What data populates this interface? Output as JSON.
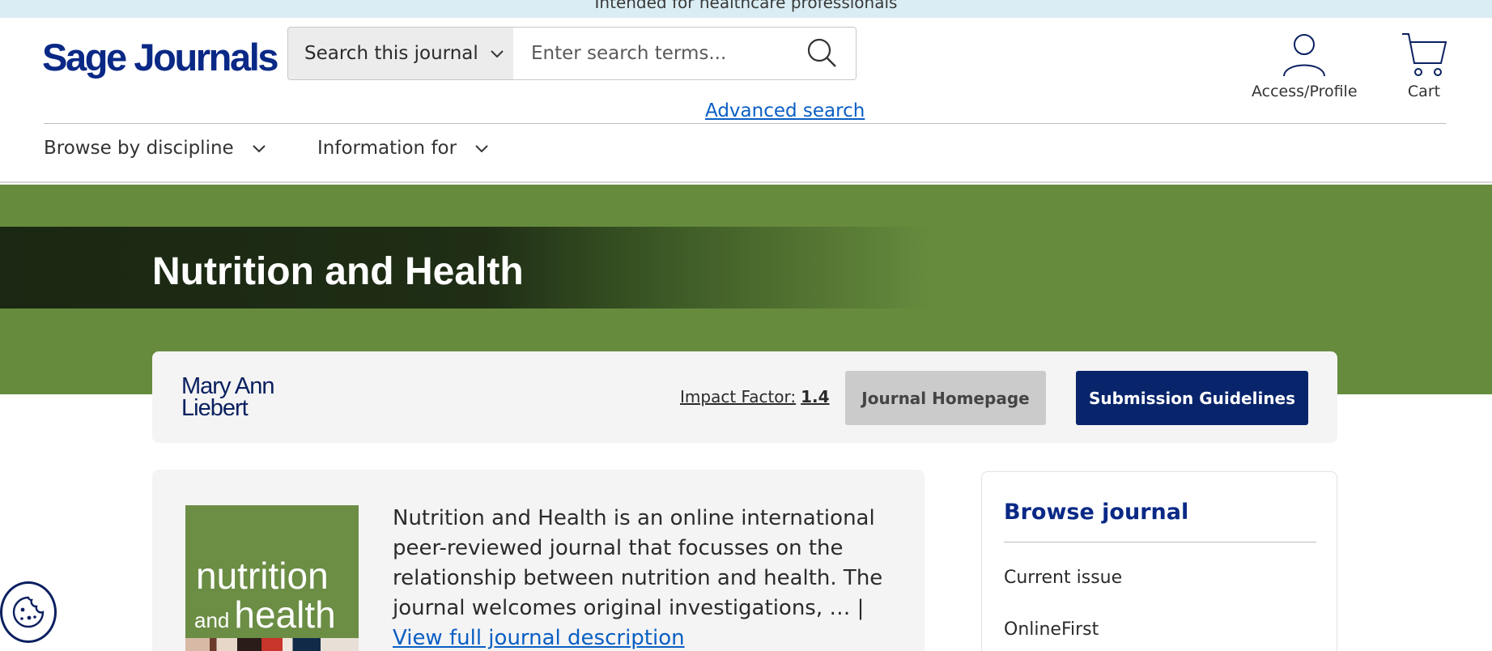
{
  "notice": {
    "text": "Intended for healthcare professionals"
  },
  "header": {
    "logo": "Sage Journals",
    "search": {
      "scope_label": "Search this journal",
      "placeholder": "Enter search terms...",
      "advanced_label": "Advanced search"
    },
    "actions": {
      "profile_label": "Access/Profile",
      "cart_label": "Cart"
    },
    "nav": {
      "browse_label": "Browse by discipline",
      "info_label": "Information for"
    }
  },
  "hero": {
    "title": "Nutrition and Health"
  },
  "info_card": {
    "publisher": {
      "line1": "Mary Ann",
      "line2": "Liebert"
    },
    "impact_label": "Impact Factor:",
    "impact_value": "1.4",
    "homepage_label": "Journal Homepage",
    "submission_label": "Submission Guidelines"
  },
  "description": {
    "cover": {
      "word1": "nutrition",
      "word2_small": "and",
      "word2_large": "health"
    },
    "text": "Nutrition and Health is an online international peer-reviewed journal that focusses on the relationship between nutrition and health. The journal welcomes original investigations, … |",
    "link_label": "View full journal description"
  },
  "browse": {
    "title": "Browse journal",
    "items": [
      "Current issue",
      "OnlineFirst"
    ]
  },
  "colors": {
    "brand_navy": "#0a2986",
    "hero_green": "#668b3d",
    "notice_bg": "#daedf4",
    "link_blue": "#0a5fc4",
    "submit_bg": "#08246b"
  },
  "icons": [
    "chevron-down-icon",
    "search-icon",
    "user-icon",
    "cart-icon",
    "cookie-icon"
  ]
}
